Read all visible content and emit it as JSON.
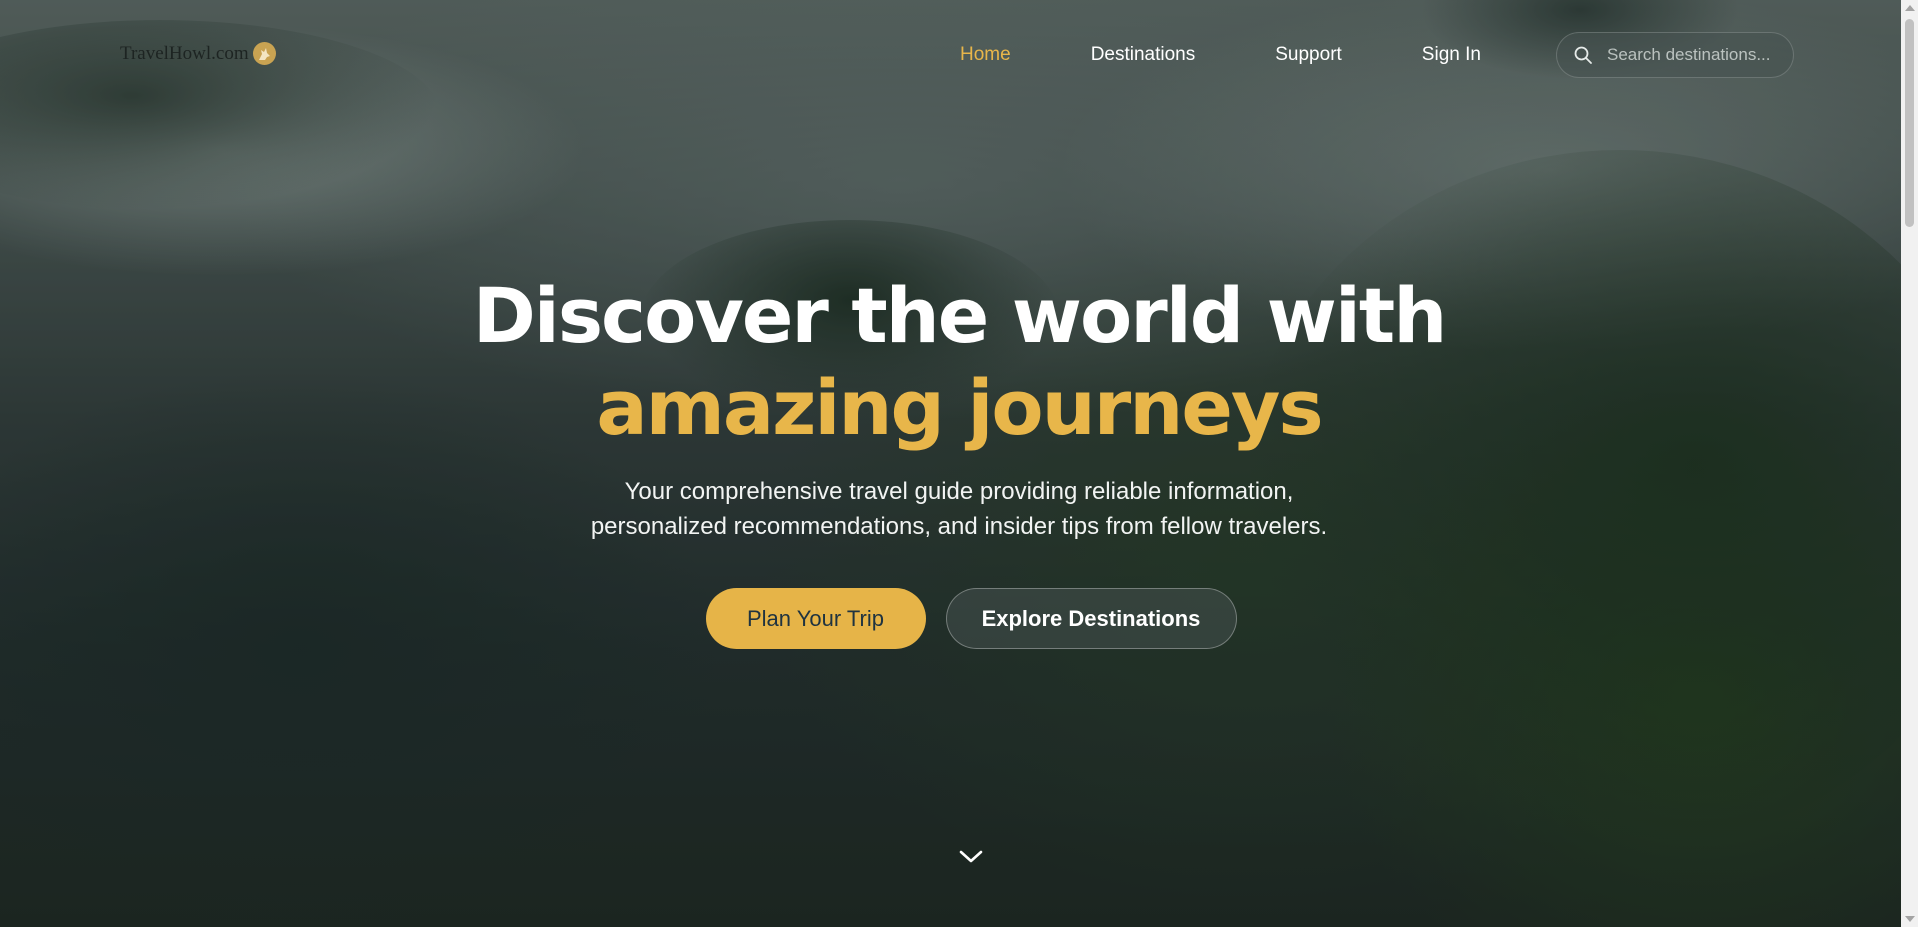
{
  "brand": {
    "name": "TravelHowl.com",
    "logo_icon": "howling-wolf-icon",
    "accent_color": "#e8b64a"
  },
  "nav": {
    "items": [
      {
        "label": "Home",
        "active": true
      },
      {
        "label": "Destinations",
        "active": false
      },
      {
        "label": "Support",
        "active": false
      },
      {
        "label": "Sign In",
        "active": false
      }
    ]
  },
  "search": {
    "placeholder": "Search destinations...",
    "value": "",
    "icon": "search-icon"
  },
  "hero": {
    "title_line1": "Discover the world with",
    "title_line2": "amazing journeys",
    "subtitle_line1": "Your comprehensive travel guide providing reliable information,",
    "subtitle_line2": "personalized recommendations, and insider tips from fellow travelers.",
    "primary_button": "Plan Your Trip",
    "secondary_button": "Explore Destinations",
    "primary_color": "#e6b448"
  },
  "scroll_indicator": {
    "icon": "chevron-down-icon"
  }
}
